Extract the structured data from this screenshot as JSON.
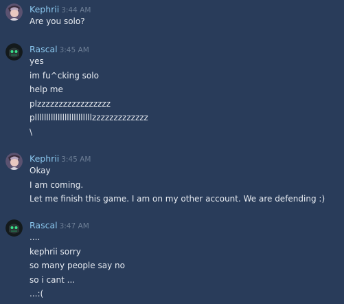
{
  "groups": [
    {
      "author": "Kephrii",
      "time": "3:44 AM",
      "avatar": "kephrii-avatar",
      "lines": [
        "Are you solo?"
      ]
    },
    {
      "author": "Rascal",
      "time": "3:45 AM",
      "avatar": "rascal-avatar",
      "lines": [
        "yes",
        "im fu^cking solo",
        "help me",
        "plzzzzzzzzzzzzzzzzz",
        "plllllllllllllllllllllllllzzzzzzzzzzzzz",
        "\\"
      ]
    },
    {
      "author": "Kephrii",
      "time": "3:45 AM",
      "avatar": "kephrii-avatar",
      "lines": [
        "Okay",
        "I am coming.",
        "Let me finish this game. I am on my other account. We are defending :)"
      ]
    },
    {
      "author": "Rascal",
      "time": "3:47 AM",
      "avatar": "rascal-avatar",
      "lines": [
        "....",
        "kephrii sorry",
        "so many people say no",
        "so i cant ...",
        "...:("
      ]
    }
  ],
  "colors": {
    "background": "#293c5a",
    "author": "#8bc8ef",
    "timestamp": "#6d7e95",
    "text": "#e8ecf2"
  }
}
